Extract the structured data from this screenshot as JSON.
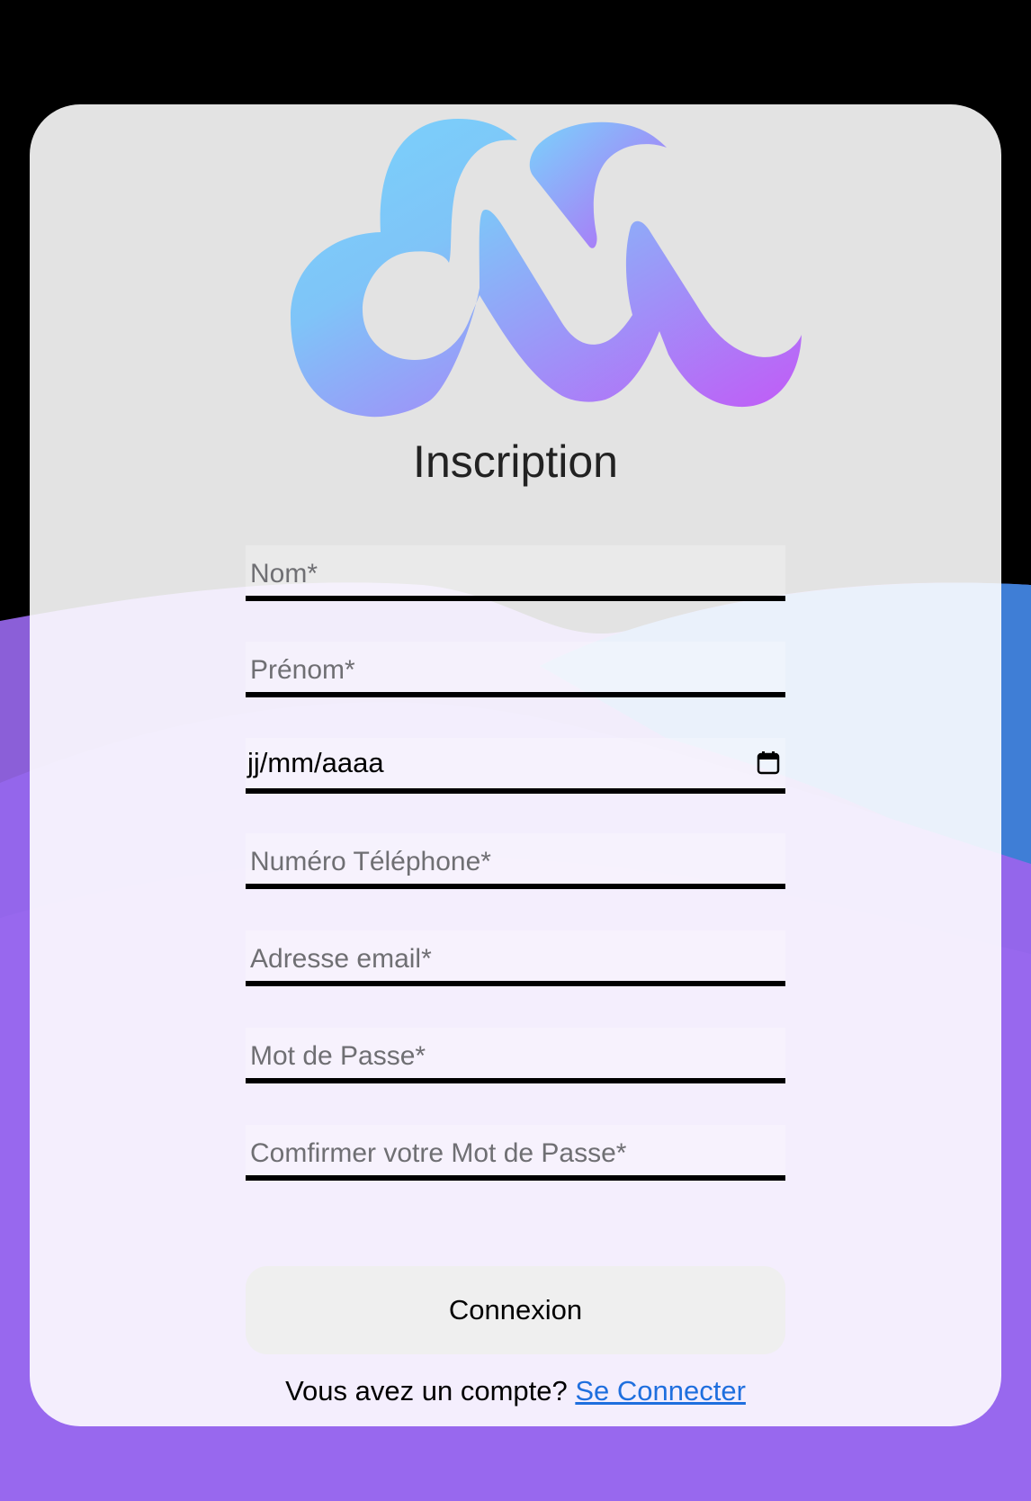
{
  "colors": {
    "page_background": "#000000",
    "wave_purple": "#9466eb",
    "wave_blue": "#3f7ed6",
    "link": "#1f6fde",
    "logo_gradient_start": "#79d3fb",
    "logo_gradient_end": "#c358f7"
  },
  "logo": {
    "icon": "double-wave-logo"
  },
  "form": {
    "title": "Inscription",
    "fields": {
      "nom": {
        "placeholder": "Nom*"
      },
      "prenom": {
        "placeholder": "Prénom*"
      },
      "date": {
        "value": "jj/mm/aaaa",
        "icon": "calendar-icon"
      },
      "telephone": {
        "placeholder": "Numéro Téléphone*"
      },
      "email": {
        "placeholder": "Adresse email*"
      },
      "password": {
        "placeholder": "Mot de Passe*"
      },
      "confirm_password": {
        "placeholder": "Comfirmer votre Mot de Passe*"
      }
    },
    "submit_label": "Connexion",
    "account_prompt": "Vous avez un compte?",
    "login_link": "Se Connecter"
  }
}
